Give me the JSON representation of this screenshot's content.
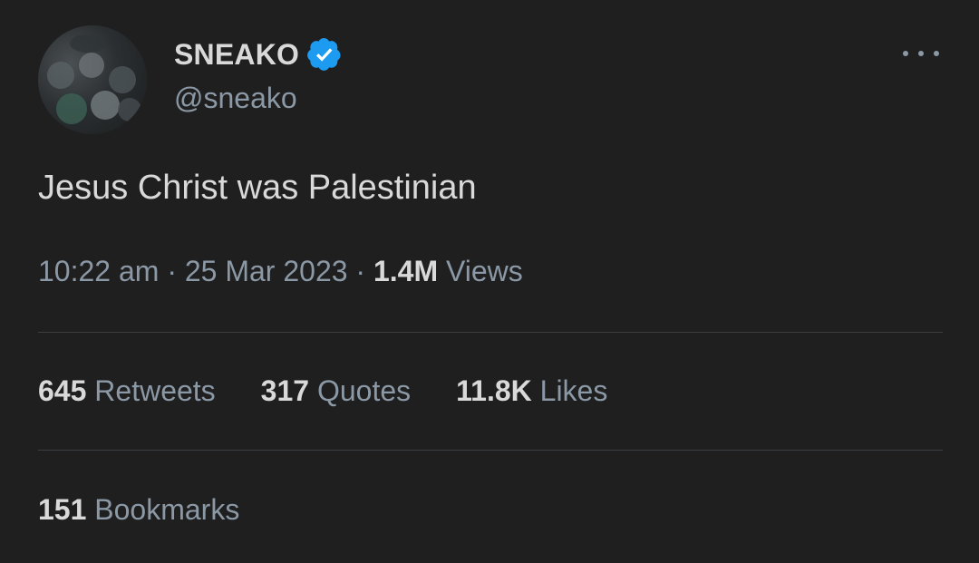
{
  "author": {
    "display_name": "SNEAKO",
    "handle": "@sneako",
    "verified_icon": "verified-badge-icon",
    "verified_color": "#1d9bf0"
  },
  "more_icon": "more-horizontal-icon",
  "tweet": {
    "text": "Jesus Christ was Palestinian",
    "time": "10:22 am",
    "date": "25 Mar 2023",
    "views_count": "1.4M",
    "views_label": "Views"
  },
  "stats": {
    "retweets": {
      "count": "645",
      "label": "Retweets"
    },
    "quotes": {
      "count": "317",
      "label": "Quotes"
    },
    "likes": {
      "count": "11.8K",
      "label": "Likes"
    },
    "bookmarks": {
      "count": "151",
      "label": "Bookmarks"
    }
  },
  "separator": " · "
}
